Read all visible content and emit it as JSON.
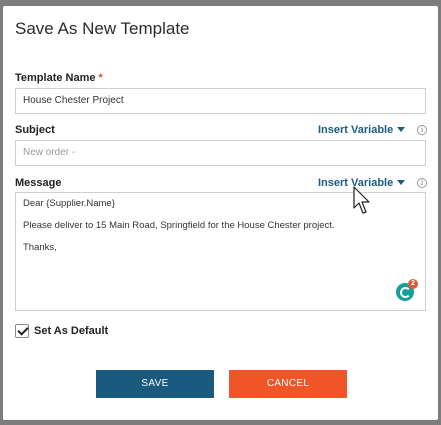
{
  "dialog": {
    "title": "Save As New Template"
  },
  "template_name": {
    "label": "Template Name",
    "required_mark": "*",
    "value": "House Chester Project"
  },
  "subject": {
    "label": "Subject",
    "insert_variable": "Insert Variable",
    "info_glyph": "i",
    "placeholder": "New order -"
  },
  "message": {
    "label": "Message",
    "insert_variable": "Insert Variable",
    "info_glyph": "i",
    "lines": [
      "Dear {Supplier.Name}",
      "Please deliver to 15 Main Road, Springfield for the House Chester project.",
      "Thanks,"
    ],
    "grammarly_count": "2"
  },
  "set_default": {
    "label": "Set As Default",
    "checked": true
  },
  "buttons": {
    "save": "SAVE",
    "cancel": "CANCEL"
  },
  "colors": {
    "accent": "#1a5a7e",
    "cancel": "#f05427",
    "required": "#e0512b",
    "link": "#1e5a80"
  }
}
